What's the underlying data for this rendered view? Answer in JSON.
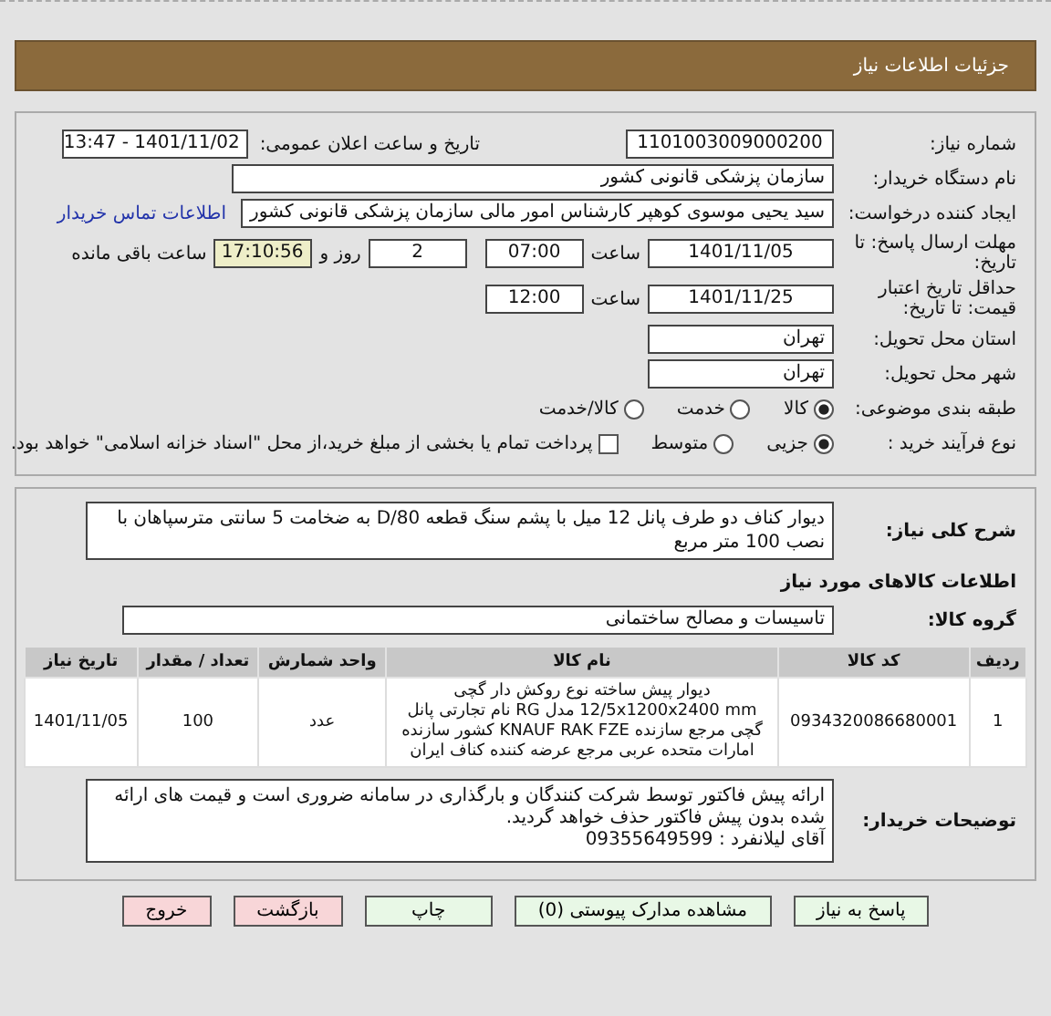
{
  "header": {
    "title": "جزئیات اطلاعات نیاز"
  },
  "need_number": {
    "label": "شماره نیاز:",
    "value": "1101003009000200"
  },
  "announce": {
    "label": "تاریخ و ساعت اعلان عمومی:",
    "value": "1401/11/02 - 13:47"
  },
  "buyer_org": {
    "label": "نام دستگاه خریدار:",
    "value": "سازمان پزشکی قانونی کشور"
  },
  "creator": {
    "label": "ایجاد کننده درخواست:",
    "value": "سید یحیی موسوی کوهپر کارشناس امور مالی سازمان پزشکی قانونی کشور",
    "link": "اطلاعات تماس خریدار"
  },
  "deadline": {
    "label": "مهلت ارسال پاسخ: تا تاریخ:",
    "date": "1401/11/05",
    "time_label": "ساعت",
    "time": "07:00",
    "days": "2",
    "days_label": "روز و",
    "remaining": "17:10:56",
    "remaining_label": "ساعت باقی مانده"
  },
  "validity": {
    "label": "حداقل تاریخ اعتبار قیمت: تا تاریخ:",
    "date": "1401/11/25",
    "time_label": "ساعت",
    "time": "12:00"
  },
  "province": {
    "label": "استان محل تحویل:",
    "value": "تهران"
  },
  "city": {
    "label": "شهر محل تحویل:",
    "value": "تهران"
  },
  "category": {
    "label": "طبقه بندی موضوعی:",
    "options": [
      {
        "label": "کالا",
        "selected": true
      },
      {
        "label": "خدمت",
        "selected": false
      },
      {
        "label": "کالا/خدمت",
        "selected": false
      }
    ]
  },
  "purchase_type": {
    "label": "نوع فرآیند خرید :",
    "options": [
      {
        "label": "جزیی",
        "selected": true
      },
      {
        "label": "متوسط",
        "selected": false
      }
    ],
    "treasury": {
      "checked": false,
      "label": "پرداخت تمام یا بخشی از مبلغ خرید،از محل \"اسناد خزانه اسلامی\" خواهد بود."
    }
  },
  "description": {
    "label": "شرح کلی نیاز:",
    "value": "دیوار کناف دو طرف پانل 12 میل با پشم سنگ قطعه D/80 به ضخامت 5 سانتی مترسپاهان با نصب 100 متر مربع"
  },
  "goods_title": "اطلاعات کالاهای مورد نیاز",
  "goods_group": {
    "label": "گروه کالا:",
    "value": "تاسیسات و مصالح ساختمانی"
  },
  "table": {
    "columns": [
      "ردیف",
      "کد کالا",
      "نام کالا",
      "واحد شمارش",
      "تعداد / مقدار",
      "تاریخ نیاز"
    ],
    "rows": [
      [
        "1",
        "0934320086680001",
        "دیوار پیش ساخته نوع روکش دار گچی 12/5x1200x2400 mm مدل RG نام تجارتی پانل گچی مرجع سازنده KNAUF RAK FZE کشور سازنده امارات متحده عربی مرجع عرضه کننده کناف ایران",
        "عدد",
        "100",
        "1401/11/05"
      ]
    ]
  },
  "buyer_notes": {
    "label": "توضیحات خریدار:",
    "lines": [
      "ارائه پیش فاکتور توسط شرکت کنندگان و بارگذاری در سامانه ضروری است و قیمت های ارائه شده بدون پیش فاکتور حذف خواهد گردید.",
      "آقای لیلانفرد : 09355649599"
    ]
  },
  "buttons": [
    {
      "label": "پاسخ به نیاز",
      "kind": "action"
    },
    {
      "label": "مشاهده مدارک پیوستی (0)",
      "kind": "action"
    },
    {
      "label": "چاپ",
      "kind": "action"
    },
    {
      "label": "بازگشت",
      "kind": "exit"
    },
    {
      "label": "خروج",
      "kind": "exit"
    }
  ]
}
